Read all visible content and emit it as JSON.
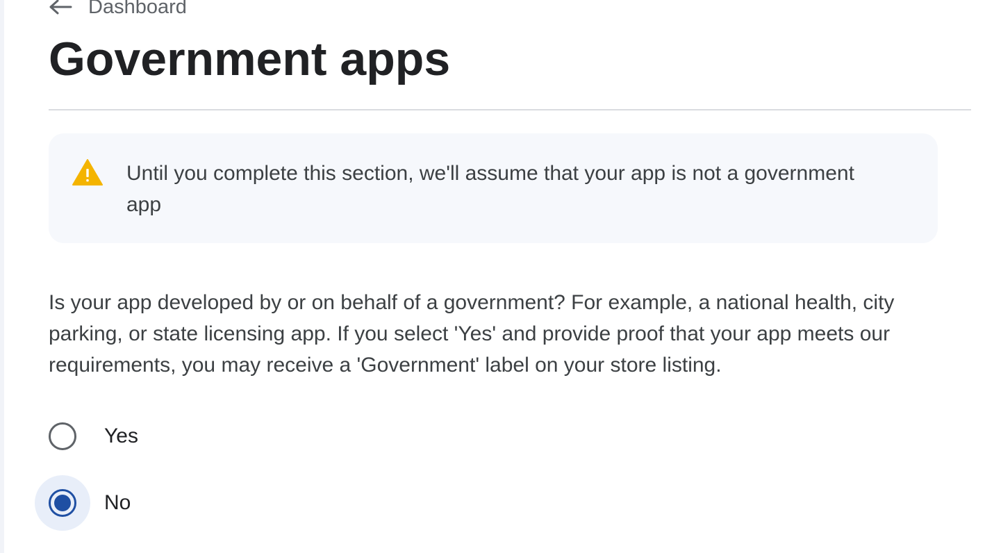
{
  "header": {
    "back_label": "Dashboard",
    "back_icon": "arrow-left-icon",
    "title": "Government apps"
  },
  "notice": {
    "icon": "warning-icon",
    "icon_color": "#f4b400",
    "text": "Until you complete this section, we'll assume that your app is not a government app"
  },
  "question": {
    "text": "Is your app developed by or on behalf of a government? For example, a national health, city parking, or state licensing app. If you select 'Yes' and provide proof that your app meets our requirements, you may receive a 'Government' label on your store listing."
  },
  "options": [
    {
      "label": "Yes",
      "selected": false
    },
    {
      "label": "No",
      "selected": true
    }
  ],
  "colors": {
    "accent": "#1f4fa3",
    "notice_background": "#f6f8fc",
    "selected_highlight": "#e8eef9"
  }
}
